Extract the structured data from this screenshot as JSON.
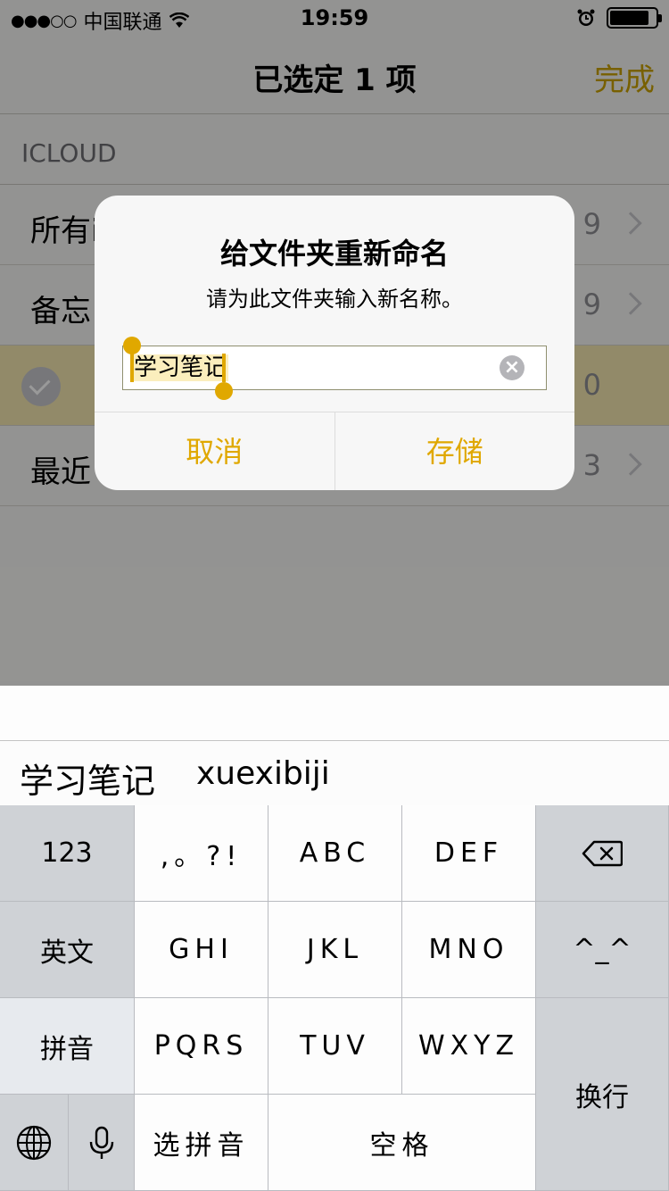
{
  "status_bar": {
    "signal": "●●●○○",
    "carrier": "中国联通",
    "time": "19:59",
    "icons": [
      "wifi-icon",
      "alarm-icon",
      "battery-icon"
    ],
    "battery_level": 0.85
  },
  "navbar": {
    "title": "已选定 1 项",
    "done_label": "完成"
  },
  "section": {
    "header": "ICLOUD"
  },
  "folders": [
    {
      "label": "所有i",
      "count": "9"
    },
    {
      "label": "备忘",
      "count": "9"
    },
    {
      "label": "",
      "count": "0",
      "selected": true
    },
    {
      "label": "最近",
      "count": "3"
    }
  ],
  "alert": {
    "title": "给文件夹重新命名",
    "message": "请为此文件夹输入新名称。",
    "field_value": "学习笔记",
    "cancel_label": "取消",
    "save_label": "存储"
  },
  "candidates": {
    "main": "学习笔记",
    "pinyin": "xuexibiji"
  },
  "keyboard": {
    "k_123": "123",
    "k_punct": ",。?!",
    "k_abc": "ABC",
    "k_def": "DEF",
    "k_english": "英文",
    "k_ghi": "GHI",
    "k_jkl": "JKL",
    "k_mno": "MNO",
    "k_emoji": "^_^",
    "k_pinyin": "拼音",
    "k_pqrs": "PQRS",
    "k_tuv": "TUV",
    "k_wxyz": "WXYZ",
    "k_return": "换行",
    "k_select_pinyin": "选拼音",
    "k_space": "空格"
  },
  "colors": {
    "accent": "#e0a800",
    "selected_row": "#f3e6b0",
    "key_gray": "#cfd2d6"
  }
}
